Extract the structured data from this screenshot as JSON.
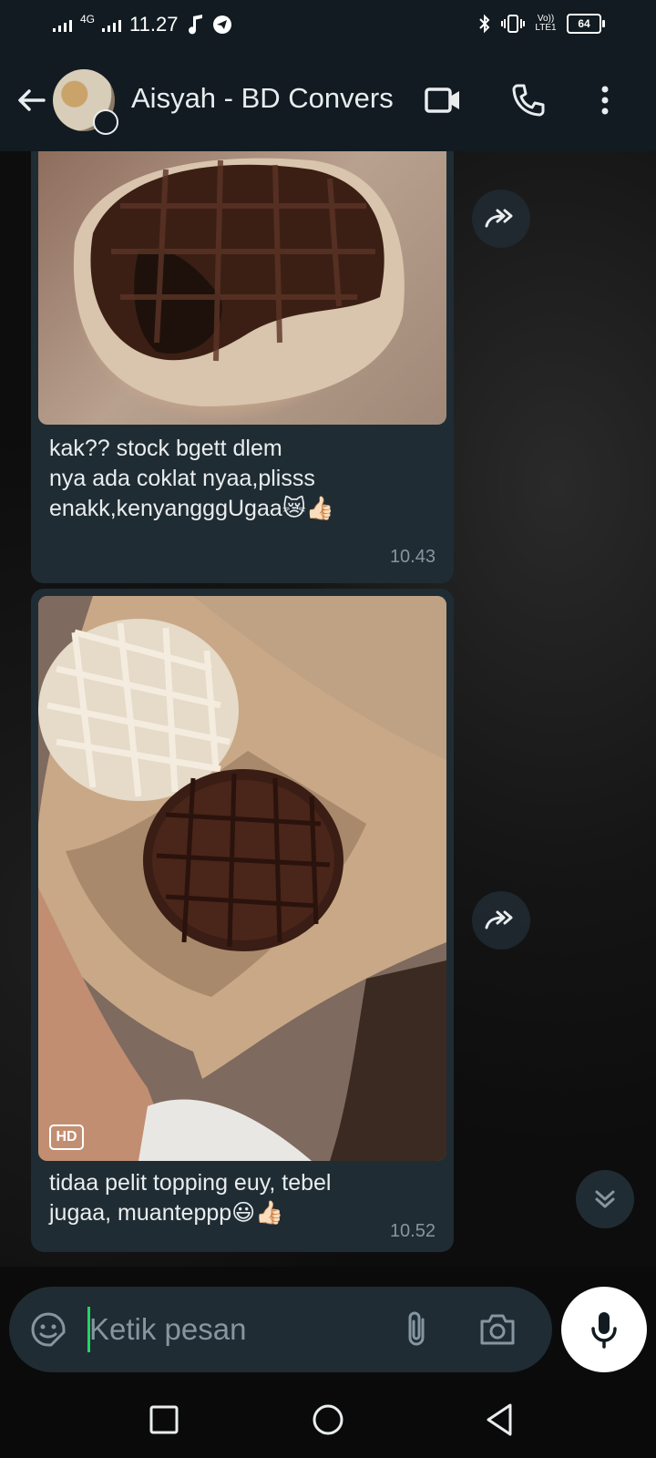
{
  "status_bar": {
    "network": "4G",
    "time": "11.27",
    "volte": "Vo)) LTE1",
    "battery": "64"
  },
  "header": {
    "contact_name": "Aisyah - BD Convers",
    "icons": [
      "back-arrow-icon",
      "video-call-icon",
      "voice-call-icon",
      "more-options-icon"
    ]
  },
  "messages": [
    {
      "type": "image",
      "caption_lines": [
        "kak?? stock bgett dlem",
        "nya ada coklat nyaa,plisss",
        "enakk,kenyangggUgaa😿👍🏻"
      ],
      "time": "10.43"
    },
    {
      "type": "image",
      "hd_badge": "HD",
      "caption_lines": [
        "tidaa pelit topping euy, tebel",
        "jugaa, muanteppp😃👍🏻"
      ],
      "time": "10.52"
    }
  ],
  "composer": {
    "placeholder": "Ketik pesan"
  },
  "colors": {
    "header_bg": "#111b21",
    "bubble_bg": "#1f2c34",
    "accent_green": "#25d366",
    "timestamp": "#8696a0"
  }
}
